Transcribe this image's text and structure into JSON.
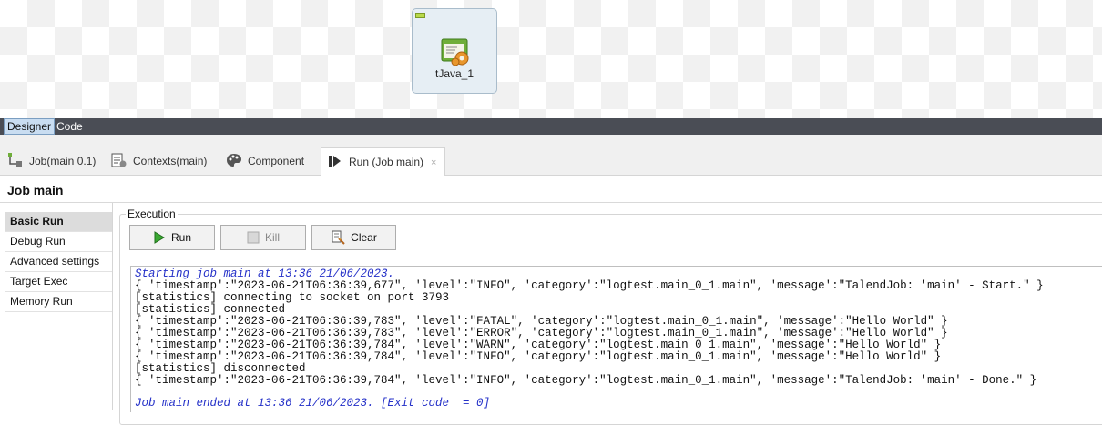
{
  "canvas": {
    "component_label": "tJava_1"
  },
  "editor_tabs": {
    "designer": "Designer",
    "code": "Code"
  },
  "view_tabs": [
    {
      "label": "Job(main 0.1)",
      "icon": "job-icon"
    },
    {
      "label": "Contexts(main)",
      "icon": "contexts-icon"
    },
    {
      "label": "Component",
      "icon": "palette-icon"
    },
    {
      "label": "Run (Job main)",
      "icon": "run-view-icon"
    }
  ],
  "view_tab_close": "×",
  "job_title": "Job main",
  "sidebar": {
    "items": [
      {
        "label": "Basic Run"
      },
      {
        "label": "Debug Run"
      },
      {
        "label": "Advanced settings"
      },
      {
        "label": "Target Exec"
      },
      {
        "label": "Memory Run"
      }
    ]
  },
  "execution": {
    "group_label": "Execution",
    "run_label": "Run",
    "kill_label": "Kill",
    "clear_label": "Clear"
  },
  "console": {
    "start_line": "Starting job main at 13:36 21/06/2023.",
    "log_lines": [
      "{ 'timestamp':\"2023-06-21T06:36:39,677\", 'level':\"INFO\", 'category':\"logtest.main_0_1.main\", 'message':\"TalendJob: 'main' - Start.\" }",
      "[statistics] connecting to socket on port 3793",
      "[statistics] connected",
      "{ 'timestamp':\"2023-06-21T06:36:39,783\", 'level':\"FATAL\", 'category':\"logtest.main_0_1.main\", 'message':\"Hello World\" }",
      "{ 'timestamp':\"2023-06-21T06:36:39,783\", 'level':\"ERROR\", 'category':\"logtest.main_0_1.main\", 'message':\"Hello World\" }",
      "{ 'timestamp':\"2023-06-21T06:36:39,784\", 'level':\"WARN\", 'category':\"logtest.main_0_1.main\", 'message':\"Hello World\" }",
      "{ 'timestamp':\"2023-06-21T06:36:39,784\", 'level':\"INFO\", 'category':\"logtest.main_0_1.main\", 'message':\"Hello World\" }",
      "[statistics] disconnected",
      "{ 'timestamp':\"2023-06-21T06:36:39,784\", 'level':\"INFO\", 'category':\"logtest.main_0_1.main\", 'message':\"TalendJob: 'main' - Done.\" }"
    ],
    "end_line": "Job main ended at 13:36 21/06/2023. [Exit code  = 0]"
  },
  "colors": {
    "console_info": "#2430c8",
    "designer_tab_bg": "#c9ddf1",
    "tab_bar_bg": "#4a4d55"
  }
}
